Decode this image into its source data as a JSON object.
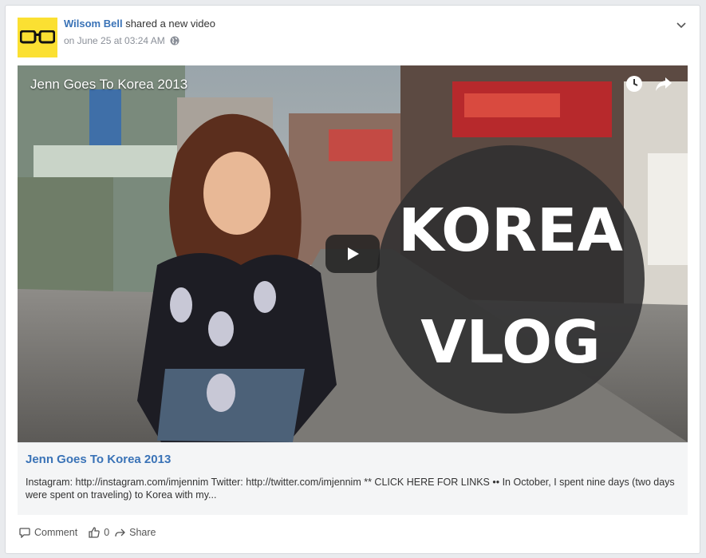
{
  "post": {
    "author": "Wilsom Bell",
    "action_text": "shared a new video",
    "date": "on June 25 at 03:24 AM",
    "privacy_icon": "globe-icon"
  },
  "video": {
    "title": "Jenn Goes To Korea 2013",
    "overlay_line1": "KOREA",
    "overlay_line2": "VLOG",
    "icons": [
      "clock-icon",
      "share-arrow-icon",
      "play-icon"
    ]
  },
  "link": {
    "title": "Jenn Goes To Korea 2013",
    "description": "Instagram: http://instagram.com/imjennim Twitter: http://twitter.com/imjennim ** CLICK HERE FOR LINKS •• In October, I spent nine days (two days were spent on traveling) to Korea with my..."
  },
  "actions": {
    "comment_label": "Comment",
    "like_count": "0",
    "share_label": "Share"
  },
  "colors": {
    "accent": "#3a73b7",
    "avatar_bg": "#fbe032"
  }
}
